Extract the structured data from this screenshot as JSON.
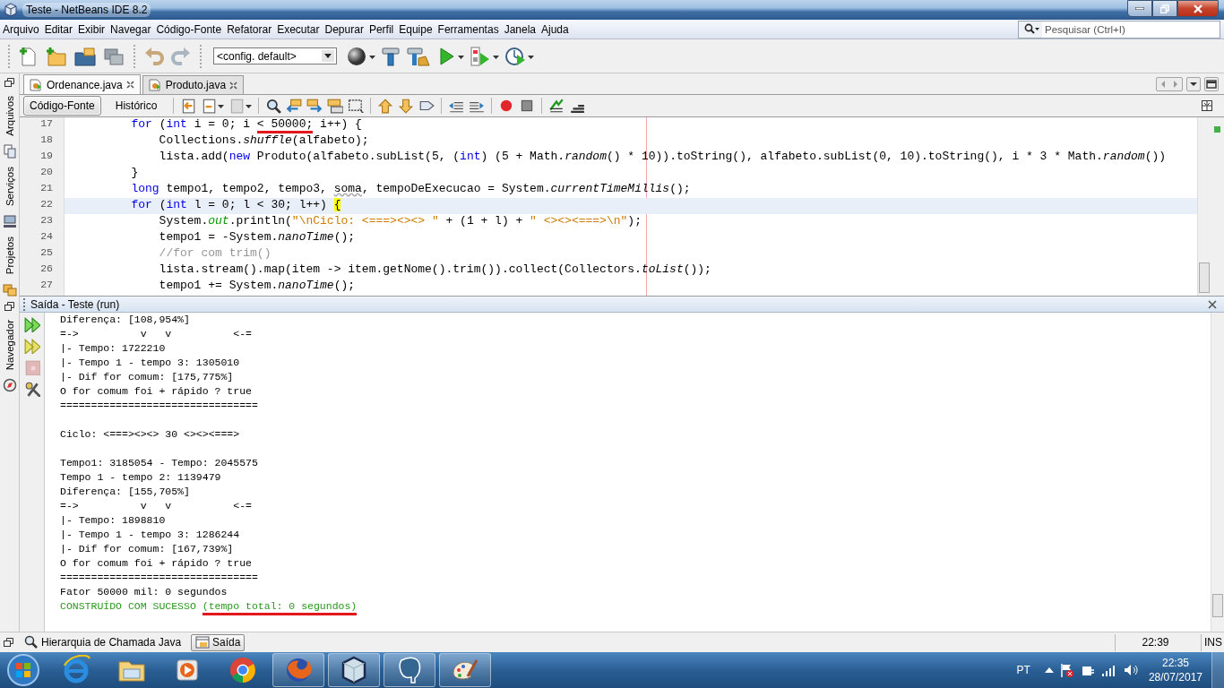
{
  "window": {
    "title": "Teste - NetBeans IDE 8.2"
  },
  "menu": [
    "Arquivo",
    "Editar",
    "Exibir",
    "Navegar",
    "Código-Fonte",
    "Refatorar",
    "Executar",
    "Depurar",
    "Perfil",
    "Equipe",
    "Ferramentas",
    "Janela",
    "Ajuda"
  ],
  "search": {
    "placeholder": "Pesquisar (Ctrl+I)"
  },
  "toolbar": {
    "config": "<config. default>"
  },
  "side_tabs": [
    {
      "label": "Arquivos"
    },
    {
      "label": "Serviços"
    },
    {
      "label": "Projetos"
    }
  ],
  "navigator_tab": {
    "label": "Navegador"
  },
  "editor": {
    "tabs": [
      {
        "label": "Ordenance.java",
        "selected": true
      },
      {
        "label": "Produto.java",
        "selected": false
      }
    ],
    "views": [
      {
        "label": "Código-Fonte",
        "selected": true
      },
      {
        "label": "Histórico",
        "selected": false
      }
    ],
    "lines": [
      {
        "number": "17",
        "current": false,
        "tokens": [
          {
            "kind": "kw",
            "text": "        for"
          },
          {
            "kind": "plain",
            "text": " ("
          },
          {
            "kind": "kw",
            "text": "int"
          },
          {
            "kind": "plain",
            "text": " i = 0; i "
          },
          {
            "kind": "marked",
            "text": "< 50000;"
          },
          {
            "kind": "plain",
            "text": " i++) {"
          }
        ]
      },
      {
        "number": "18",
        "current": false,
        "tokens": [
          {
            "kind": "plain",
            "text": "            Collections."
          },
          {
            "kind": "static",
            "text": "shuffle"
          },
          {
            "kind": "plain",
            "text": "(alfabeto);"
          }
        ]
      },
      {
        "number": "19",
        "current": false,
        "tokens": [
          {
            "kind": "plain",
            "text": "            lista.add("
          },
          {
            "kind": "kw",
            "text": "new"
          },
          {
            "kind": "plain",
            "text": " Produto(alfabeto.subList(5, ("
          },
          {
            "kind": "kw",
            "text": "int"
          },
          {
            "kind": "plain",
            "text": ") (5 + Math."
          },
          {
            "kind": "static",
            "text": "random"
          },
          {
            "kind": "plain",
            "text": "() * 10)).toString(), alfabeto.subList(0, 10).toString(), i * 3 * Math."
          },
          {
            "kind": "static",
            "text": "random"
          },
          {
            "kind": "plain",
            "text": "())"
          }
        ]
      },
      {
        "number": "20",
        "current": false,
        "tokens": [
          {
            "kind": "plain",
            "text": "        }"
          }
        ]
      },
      {
        "number": "21",
        "current": false,
        "tokens": [
          {
            "kind": "kw",
            "text": "        long"
          },
          {
            "kind": "plain",
            "text": " tempo1, tempo2, tempo3, "
          },
          {
            "kind": "warn",
            "text": "soma"
          },
          {
            "kind": "plain",
            "text": ", tempoDeExecucao = System."
          },
          {
            "kind": "static",
            "text": "currentTimeMillis"
          },
          {
            "kind": "plain",
            "text": "();"
          }
        ]
      },
      {
        "number": "22",
        "current": true,
        "tokens": [
          {
            "kind": "kw",
            "text": "        for"
          },
          {
            "kind": "plain",
            "text": " ("
          },
          {
            "kind": "kw",
            "text": "int"
          },
          {
            "kind": "plain",
            "text": " l = 0; l < 30; l++) "
          },
          {
            "kind": "brace",
            "text": "{"
          }
        ]
      },
      {
        "number": "23",
        "current": false,
        "tokens": [
          {
            "kind": "plain",
            "text": "            System."
          },
          {
            "kind": "field",
            "text": "out"
          },
          {
            "kind": "plain",
            "text": ".println("
          },
          {
            "kind": "str",
            "text": "\"\\nCiclo: <===><><> \""
          },
          {
            "kind": "plain",
            "text": " + (1 + l) + "
          },
          {
            "kind": "str",
            "text": "\" <><><===>\\n\""
          },
          {
            "kind": "plain",
            "text": ");"
          }
        ]
      },
      {
        "number": "24",
        "current": false,
        "tokens": [
          {
            "kind": "plain",
            "text": "            tempo1 = -System."
          },
          {
            "kind": "static",
            "text": "nanoTime"
          },
          {
            "kind": "plain",
            "text": "();"
          }
        ]
      },
      {
        "number": "25",
        "current": false,
        "tokens": [
          {
            "kind": "comment",
            "text": "            //for com trim()"
          }
        ]
      },
      {
        "number": "26",
        "current": false,
        "tokens": [
          {
            "kind": "plain",
            "text": "            lista.stream().map(item -> item.getNome().trim()).collect(Collectors."
          },
          {
            "kind": "static",
            "text": "toList"
          },
          {
            "kind": "plain",
            "text": "());"
          }
        ]
      },
      {
        "number": "27",
        "current": false,
        "tokens": [
          {
            "kind": "plain",
            "text": "            tempo1 += System."
          },
          {
            "kind": "static",
            "text": "nanoTime"
          },
          {
            "kind": "plain",
            "text": "();"
          }
        ]
      }
    ]
  },
  "output": {
    "title": "Saída - Teste (run)",
    "lines": [
      {
        "kind": "normal",
        "text": "Diferença: [108,954%]"
      },
      {
        "kind": "normal",
        "text": "=->          v   v          <-="
      },
      {
        "kind": "normal",
        "text": "|- Tempo: 1722210"
      },
      {
        "kind": "normal",
        "text": "|- Tempo 1 - tempo 3: 1305010"
      },
      {
        "kind": "normal",
        "text": "|- Dif for comum: [175,775%]"
      },
      {
        "kind": "normal",
        "text": "O for comum foi + rápido ? true"
      },
      {
        "kind": "normal",
        "text": "================================"
      },
      {
        "kind": "blank"
      },
      {
        "kind": "normal",
        "text": "Ciclo: <===><><> 30 <><><===>"
      },
      {
        "kind": "blank"
      },
      {
        "kind": "normal",
        "text": "Tempo1: 3185054 - Tempo: 2045575"
      },
      {
        "kind": "normal",
        "text": "Tempo 1 - tempo 2: 1139479"
      },
      {
        "kind": "normal",
        "text": "Diferença: [155,705%]"
      },
      {
        "kind": "normal",
        "text": "=->          v   v          <-="
      },
      {
        "kind": "normal",
        "text": "|- Tempo: 1898810"
      },
      {
        "kind": "normal",
        "text": "|- Tempo 1 - tempo 3: 1286244"
      },
      {
        "kind": "normal",
        "text": "|- Dif for comum: [167,739%]"
      },
      {
        "kind": "normal",
        "text": "O for comum foi + rápido ? true"
      },
      {
        "kind": "normal",
        "text": "================================"
      },
      {
        "kind": "normal",
        "text": "Fator 50000 mil: 0 segundos"
      },
      {
        "kind": "success",
        "text": "CONSTRUÍDO COM SUCESSO",
        "note": "(tempo total: 0 segundos)"
      }
    ]
  },
  "bottom_tabs": [
    {
      "label": "Hierarquia de Chamada Java",
      "selected": false
    },
    {
      "label": "Saída",
      "selected": true
    }
  ],
  "status": {
    "position": "22:39",
    "mode": "INS"
  },
  "taskbar": {
    "apps": [
      {
        "running": false
      },
      {
        "running": false
      },
      {
        "running": false
      },
      {
        "running": false
      },
      {
        "running": true
      },
      {
        "running": true
      },
      {
        "running": true
      },
      {
        "running": true
      }
    ],
    "language": "PT",
    "time": "22:35",
    "date": "28/07/2017"
  }
}
